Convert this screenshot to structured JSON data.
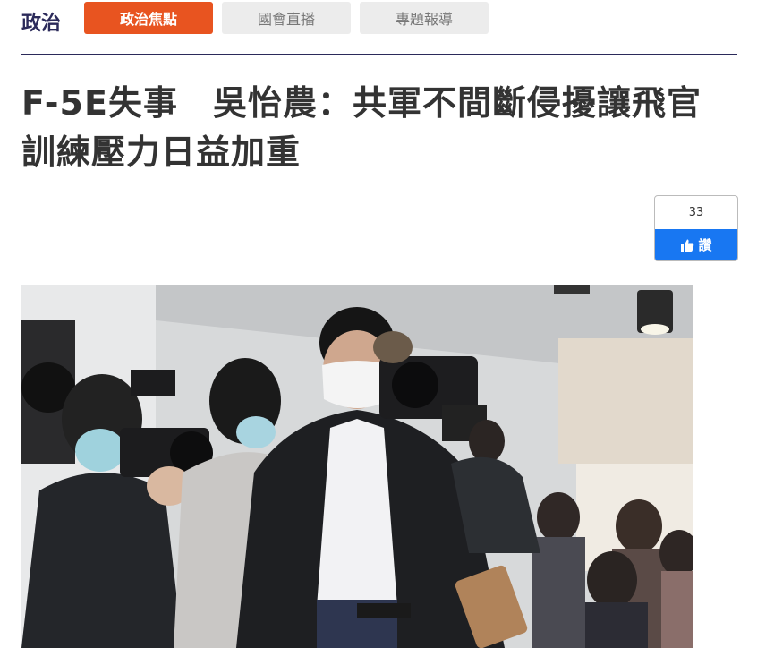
{
  "header": {
    "section_title": "政治",
    "tabs": [
      {
        "label": "政治焦點",
        "active": true
      },
      {
        "label": "國會直播",
        "active": false
      },
      {
        "label": "專題報導",
        "active": false
      }
    ]
  },
  "article": {
    "headline_line1": "F-5E失事　吳怡農：共軍不間斷侵擾讓飛官",
    "headline_line2": "訓練壓力日益加重"
  },
  "like": {
    "count": "33",
    "label": "讚",
    "icon": "thumbs-up-icon"
  },
  "colors": {
    "accent": "#e85420",
    "brand": "#2b2a5a",
    "facebook": "#1877f2"
  }
}
